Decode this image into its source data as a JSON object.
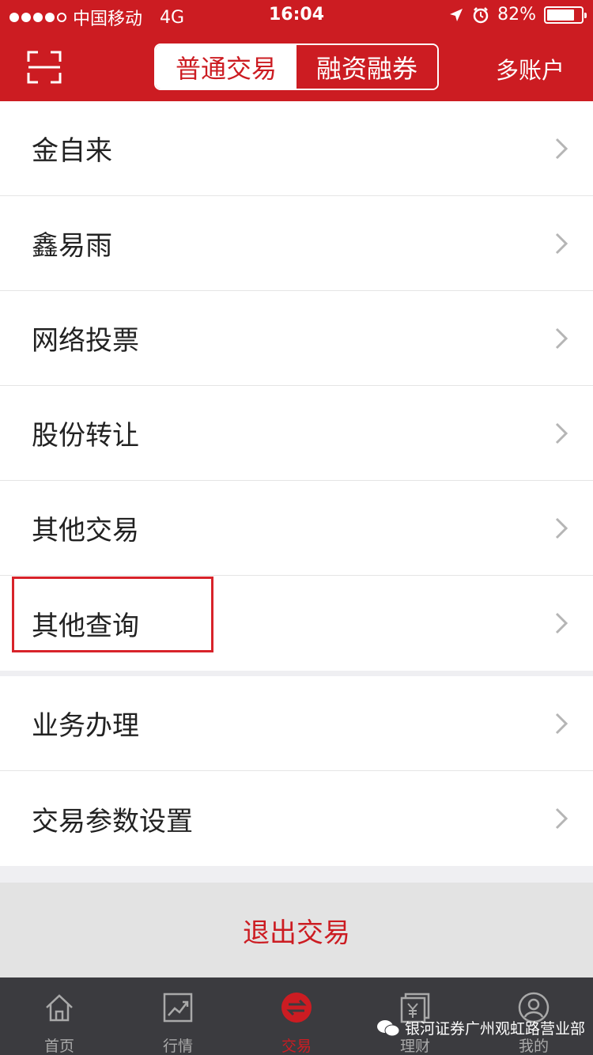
{
  "status_bar": {
    "carrier": "中国移动",
    "network": "4G",
    "time": "16:04",
    "battery": "82%",
    "battery_level": 0.82
  },
  "header": {
    "segments": [
      "普通交易",
      "融资融券"
    ],
    "right_link": "多账户"
  },
  "menu": [
    "金自来",
    "鑫易雨",
    "网络投票",
    "股份转让",
    "其他交易",
    "其他查询"
  ],
  "menu2": [
    "业务办理",
    "交易参数设置"
  ],
  "logout_label": "退出交易",
  "tabs": [
    "首页",
    "行情",
    "交易",
    "理财",
    "我的"
  ],
  "watermark": "银河证券广州观虹路营业部",
  "colors": {
    "brand_red": "#cc1c22",
    "tabbar_bg": "#3b3b3f"
  }
}
